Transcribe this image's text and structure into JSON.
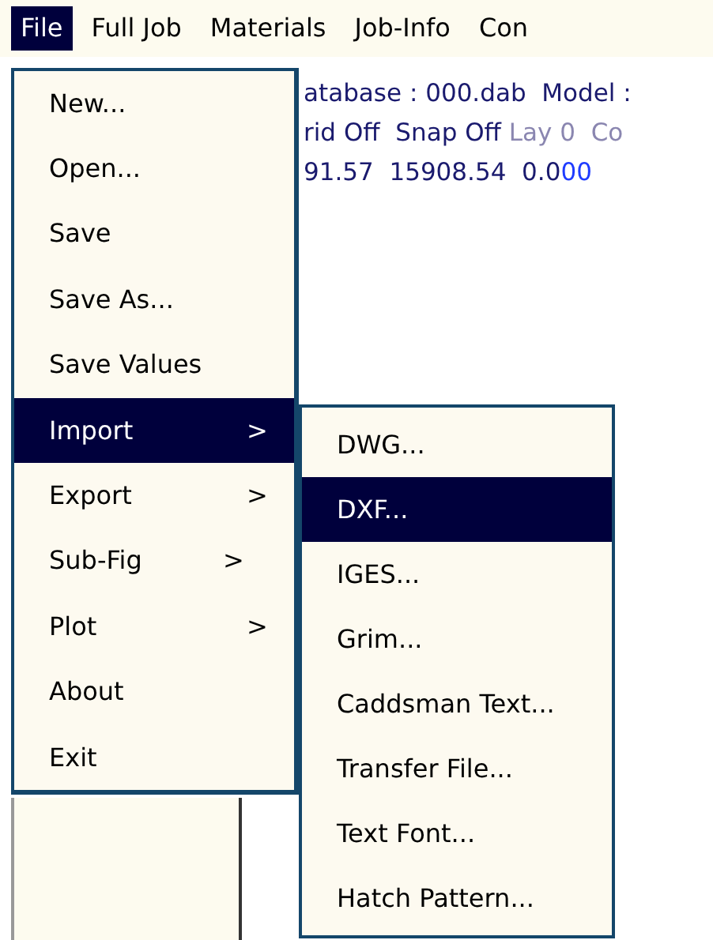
{
  "menubar": [
    {
      "label": "File",
      "selected": true
    },
    {
      "label": "Full Job",
      "selected": false
    },
    {
      "label": "Materials",
      "selected": false
    },
    {
      "label": "Job-Info",
      "selected": false
    },
    {
      "label": "Con",
      "selected": false
    }
  ],
  "status_lines": [
    [
      {
        "text": "atabase : 000.dab  Model :",
        "kind": "normal"
      }
    ],
    [
      {
        "text": "rid Off  Snap Off",
        "kind": "normal"
      },
      {
        "text": " Lay 0  Co",
        "kind": "dim"
      }
    ],
    [
      {
        "text": "91.57  15908.54  0.0",
        "kind": "normal"
      },
      {
        "text": "00",
        "kind": "accent"
      }
    ]
  ],
  "file_menu": [
    {
      "label": "New...",
      "selected": false
    },
    {
      "label": "Open...",
      "selected": false
    },
    {
      "label": "Save",
      "selected": false
    },
    {
      "label": "Save As...",
      "selected": false
    },
    {
      "label": "Save Values",
      "selected": false
    },
    {
      "label": "Import",
      "arrow": ">",
      "selected": true
    },
    {
      "label": "Export",
      "arrow": ">",
      "selected": false
    },
    {
      "label": "Sub-Fig",
      "arrow": ">",
      "selected": false
    },
    {
      "label": "Plot",
      "arrow": ">",
      "selected": false
    },
    {
      "label": "About",
      "selected": false
    },
    {
      "label": "Exit",
      "selected": false
    }
  ],
  "import_submenu": [
    {
      "label": "DWG...",
      "selected": false
    },
    {
      "label": "DXF...",
      "selected": true
    },
    {
      "label": "IGES...",
      "selected": false
    },
    {
      "label": "Grim...",
      "selected": false
    },
    {
      "label": "Caddsman Text...",
      "selected": false
    },
    {
      "label": "Transfer File...",
      "selected": false
    },
    {
      "label": "Text Font...",
      "selected": false
    },
    {
      "label": "Hatch Pattern...",
      "selected": false
    }
  ]
}
